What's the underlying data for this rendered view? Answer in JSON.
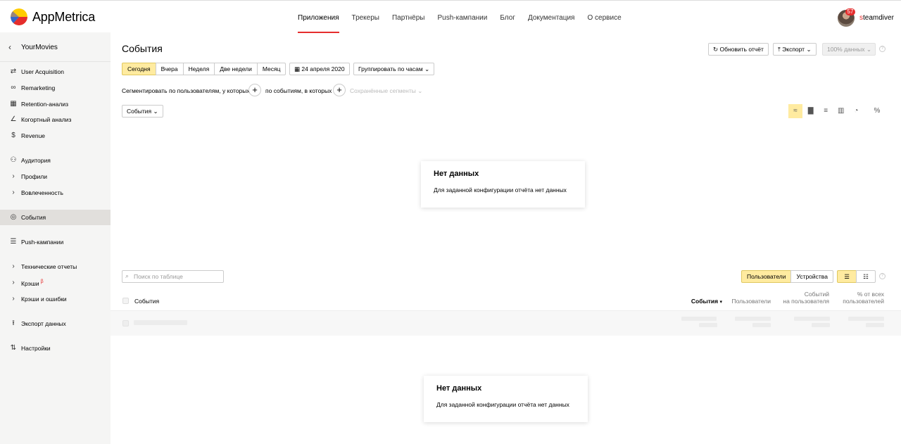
{
  "header": {
    "brand": "AppMetrica",
    "nav": [
      {
        "label": "Приложения",
        "active": true
      },
      {
        "label": "Трекеры",
        "active": false
      },
      {
        "label": "Партнёры",
        "active": false
      },
      {
        "label": "Push-кампании",
        "active": false
      },
      {
        "label": "Блог",
        "active": false
      },
      {
        "label": "Документация",
        "active": false
      },
      {
        "label": "О сервисе",
        "active": false
      }
    ],
    "user": {
      "badge": "57",
      "name_first": "s",
      "name_rest": "teamdiver"
    }
  },
  "sidebar": {
    "app_name": "YourMovies",
    "items": [
      {
        "label": "User Acquisition",
        "icon": "arrows-icon"
      },
      {
        "label": "Remarketing",
        "icon": "link-icon"
      },
      {
        "label": "Retention-анализ",
        "icon": "grid-icon"
      },
      {
        "label": "Когортный анализ",
        "icon": "curve-icon"
      },
      {
        "label": "Revenue",
        "icon": "dollar-icon"
      },
      {
        "label": "Аудитория",
        "icon": "audience-icon"
      },
      {
        "label": "Профили",
        "icon": "chevron-right-icon"
      },
      {
        "label": "Вовлеченность",
        "icon": "chevron-right-icon"
      },
      {
        "label": "События",
        "icon": "target-icon",
        "active": true
      },
      {
        "label": "Push-кампании",
        "icon": "message-icon"
      },
      {
        "label": "Технические отчеты",
        "icon": "chevron-right-icon"
      },
      {
        "label": "Крэши",
        "icon": "chevron-right-icon",
        "beta": "β"
      },
      {
        "label": "Крэши и ошибки",
        "icon": "chevron-right-icon"
      },
      {
        "label": "Экспорт данных",
        "icon": "export-icon"
      },
      {
        "label": "Настройки",
        "icon": "settings-icon"
      }
    ]
  },
  "main": {
    "title": "События",
    "toolbar": {
      "refresh": "Обновить отчёт",
      "export": "Экспорт",
      "sampling": "100% данных"
    },
    "periods": [
      {
        "label": "Сегодня",
        "active": true
      },
      {
        "label": "Вчера",
        "active": false
      },
      {
        "label": "Неделя",
        "active": false
      },
      {
        "label": "Две недели",
        "active": false
      },
      {
        "label": "Месяц",
        "active": false
      }
    ],
    "date": "24 апреля 2020",
    "group_by": "Группировать по часам",
    "segment": {
      "by_users": "Сегментировать по пользователям, у которых",
      "by_events": "по событиям, в которых",
      "saved": "Сохранённые сегменты"
    },
    "dimension_select": "События",
    "nodata": {
      "title": "Нет данных",
      "text": "Для заданной конфигурации отчёта нет данных"
    },
    "table": {
      "search_placeholder": "Поиск по таблице",
      "toggle": [
        {
          "label": "Пользователи",
          "active": true
        },
        {
          "label": "Устройства",
          "active": false
        }
      ],
      "columns": {
        "name": "События",
        "events": "События",
        "users": "Пользователи",
        "per_user_1": "Событий",
        "per_user_2": "на пользователя",
        "pct_1": "% от всех",
        "pct_2": "пользователей"
      },
      "sort_arrow": "▾"
    }
  },
  "colors": {
    "accent": "#e52d2d",
    "active": "#ffeba0",
    "sidebar_bg": "#f5f5f4"
  }
}
